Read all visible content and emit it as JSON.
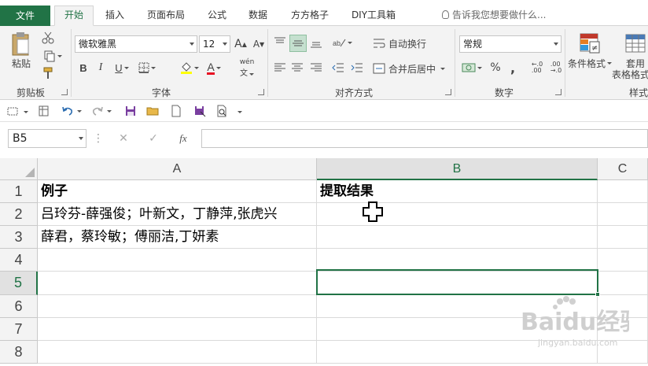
{
  "ribbon_tabs": {
    "file": "文件",
    "home": "开始",
    "insert": "插入",
    "page_layout": "页面布局",
    "formulas": "公式",
    "data": "数据",
    "fangfang": "方方格子",
    "diy": "DIY工具箱",
    "tell_me": "告诉我您想要做什么..."
  },
  "clipboard": {
    "paste": "粘贴",
    "group_label": "剪贴板"
  },
  "font": {
    "name": "微软雅黑",
    "size": "12",
    "bold": "B",
    "italic": "I",
    "underline": "U",
    "grow": "A",
    "shrink": "A",
    "font_color": "A",
    "phonetic": "wén",
    "group_label": "字体",
    "font_color_hex": "#e81123",
    "fill_color_hex": "#ffff00"
  },
  "alignment": {
    "wrap_text": "自动换行",
    "merge_center": "合并后居中",
    "group_label": "对齐方式"
  },
  "number": {
    "format": "常规",
    "percent": "%",
    "comma": ",",
    "group_label": "数字"
  },
  "styles": {
    "conditional_format": "条件格式",
    "format_as_table_1": "套用",
    "format_as_table_2": "表格格式",
    "group_label": "样式"
  },
  "formula_bar": {
    "name_box": "B5",
    "fx": "fx",
    "value": ""
  },
  "grid": {
    "columns": [
      "A",
      "B",
      "C"
    ],
    "rows": [
      "1",
      "2",
      "3",
      "4",
      "5",
      "6",
      "7",
      "8"
    ],
    "cells": {
      "A1": "例子",
      "B1": "提取结果",
      "A2": "吕玲芬-薛强俊；叶新文，丁静萍,张虎兴",
      "A3": "薛君，蔡玲敏；傅丽洁,丁妍素"
    },
    "selected_cell": "B5",
    "accent": "#217346"
  },
  "watermark": {
    "brand": "Baidu经验",
    "url": "jingyan.baidu.com"
  }
}
